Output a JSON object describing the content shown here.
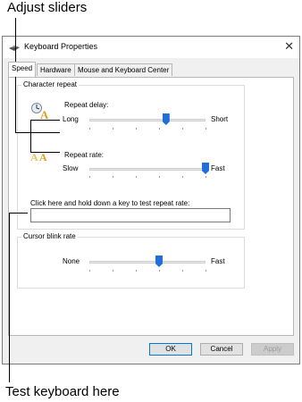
{
  "callouts": {
    "top": "Adjust sliders",
    "bottom": "Test keyboard here"
  },
  "window": {
    "title": "Keyboard Properties",
    "close_icon": "close-icon"
  },
  "tabs": [
    {
      "label": "Speed",
      "active": true
    },
    {
      "label": "Hardware",
      "active": false
    },
    {
      "label": "Mouse and Keyboard Center",
      "active": false
    }
  ],
  "character_repeat": {
    "group_label": "Character repeat",
    "repeat_delay": {
      "label": "Repeat delay:",
      "min_label": "Long",
      "max_label": "Short",
      "value": 0.66
    },
    "repeat_rate": {
      "label": "Repeat rate:",
      "min_label": "Slow",
      "max_label": "Fast",
      "value": 1.0
    },
    "test_label": "Click here and hold down a key to test repeat rate:",
    "test_value": ""
  },
  "cursor_blink": {
    "group_label": "Cursor blink rate",
    "min_label": "None",
    "max_label": "Fast",
    "value": 0.6
  },
  "buttons": {
    "ok": "OK",
    "cancel": "Cancel",
    "apply": "Apply"
  },
  "colors": {
    "thumb": "#1f6fd6",
    "accent": "#0078d7"
  }
}
